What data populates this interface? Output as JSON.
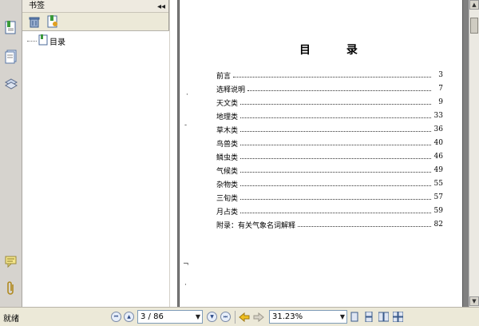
{
  "bookmarks_panel": {
    "title": "书签",
    "collapse_glyph": "◂◂",
    "tree": [
      {
        "label": "目录"
      }
    ]
  },
  "page": {
    "toc_title": "目 录",
    "toc": [
      {
        "label": "前言",
        "page": "3"
      },
      {
        "label": "选释说明",
        "page": "7"
      },
      {
        "label": "天文类",
        "page": "9"
      },
      {
        "label": "地理类",
        "page": "33"
      },
      {
        "label": "草木类",
        "page": "36"
      },
      {
        "label": "鸟兽类",
        "page": "40"
      },
      {
        "label": "鳞虫类",
        "page": "46"
      },
      {
        "label": "气候类",
        "page": "49"
      },
      {
        "label": "杂物类",
        "page": "55"
      },
      {
        "label": "三旬类",
        "page": "57"
      },
      {
        "label": "月占类",
        "page": "59"
      },
      {
        "label": "附录：有关气象名词解释",
        "page": "82"
      }
    ]
  },
  "statusbar": {
    "status": "就绪",
    "page_indicator": "3 / 86",
    "zoom": "31.23%"
  },
  "icons": {
    "rail": [
      "bookmarks-icon",
      "pages-icon",
      "layers-icon",
      "comments-icon",
      "attachments-icon"
    ],
    "toolbar": [
      "delete-icon",
      "new-bookmark-icon"
    ]
  },
  "colors": {
    "accent_blue": "#2c4a86",
    "page_bg": "#ffffff",
    "viewer_bg": "#808080"
  }
}
